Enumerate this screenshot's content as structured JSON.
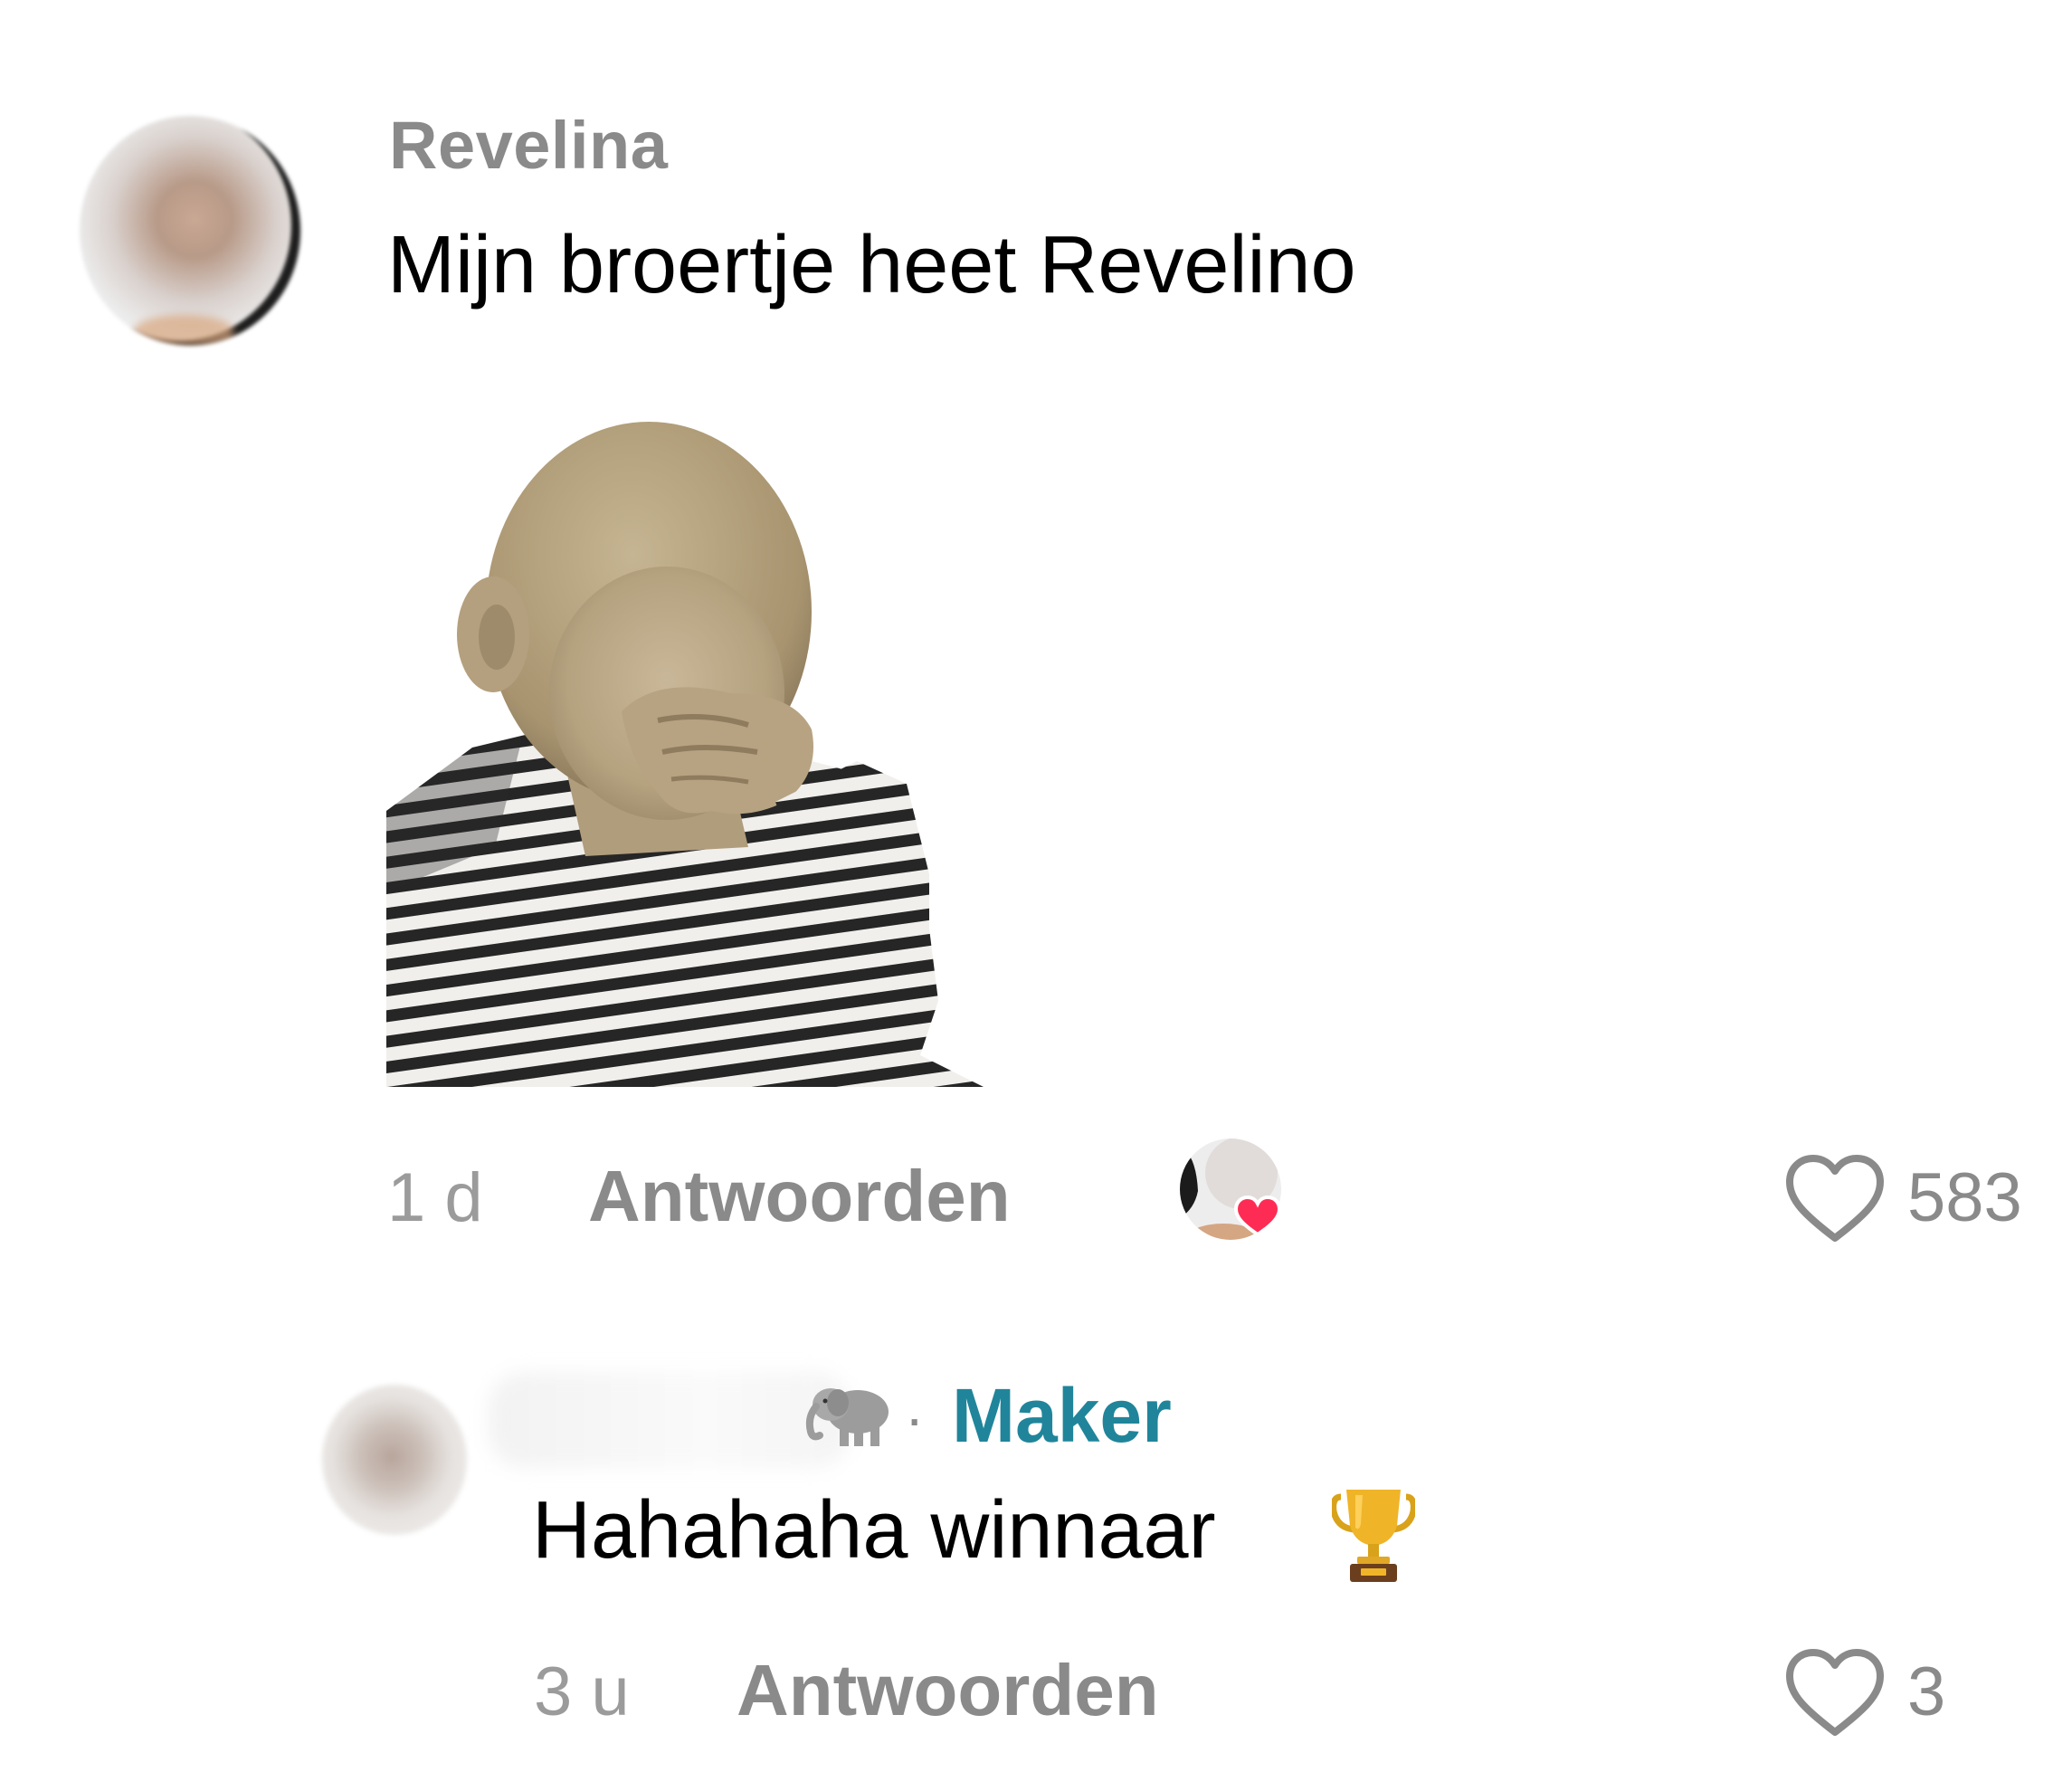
{
  "comment": {
    "author": "Revelina",
    "text": "Mijn broertje heet Revelino",
    "time": "1 d",
    "reply_label": "Antwoorden",
    "likes": "583",
    "sticker": "baby-facepalm-sticker"
  },
  "reply": {
    "badge": "Maker",
    "separator": "·",
    "text": "Hahahaha winnaar",
    "emoji": "trophy",
    "time": "3 u",
    "reply_label": "Antwoorden",
    "likes": "3"
  },
  "colors": {
    "maker_badge": "#20859a",
    "muted_text": "#8a8a8a",
    "heart_outline": "#8a8a8a",
    "liked_heart": "#fe2c55"
  }
}
